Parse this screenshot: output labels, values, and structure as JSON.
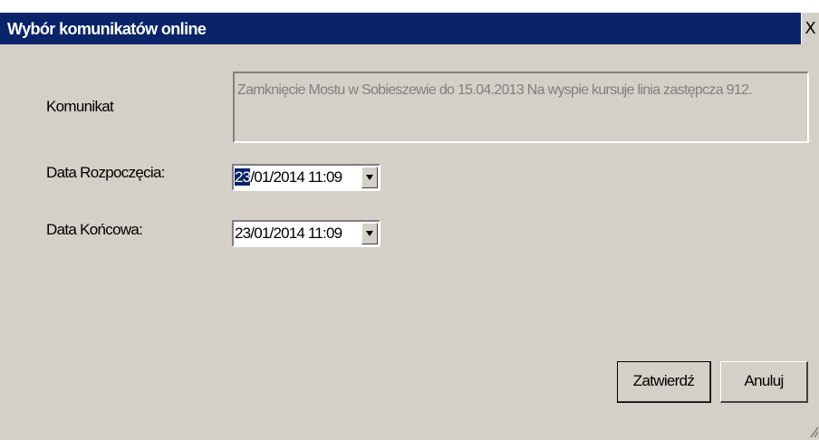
{
  "window": {
    "title": "Wybór komunikatów online",
    "close_glyph": "X"
  },
  "form": {
    "komunikat_label": "Komunikat",
    "komunikat_text": "Zamknięcie Mostu w Sobieszewie do 15.04.2013 Na wyspie kursuje linia zastępcza 912.",
    "start_label": "Data Rozpoczęcia:",
    "start_value_selected": "23",
    "start_value_rest": "/01/2014 11:09",
    "end_label": "Data Końcowa:",
    "end_value": "23/01/2014 11:09"
  },
  "buttons": {
    "confirm_label": "Zatwierdź",
    "cancel_label": "Anuluj"
  },
  "colors": {
    "titlebar": "#0a246a",
    "face": "#d4d0c8",
    "disabled_text": "#808080"
  },
  "icons": {
    "close": "close-icon",
    "dropdown": "chevron-down-icon",
    "resize": "resize-grip-icon"
  }
}
